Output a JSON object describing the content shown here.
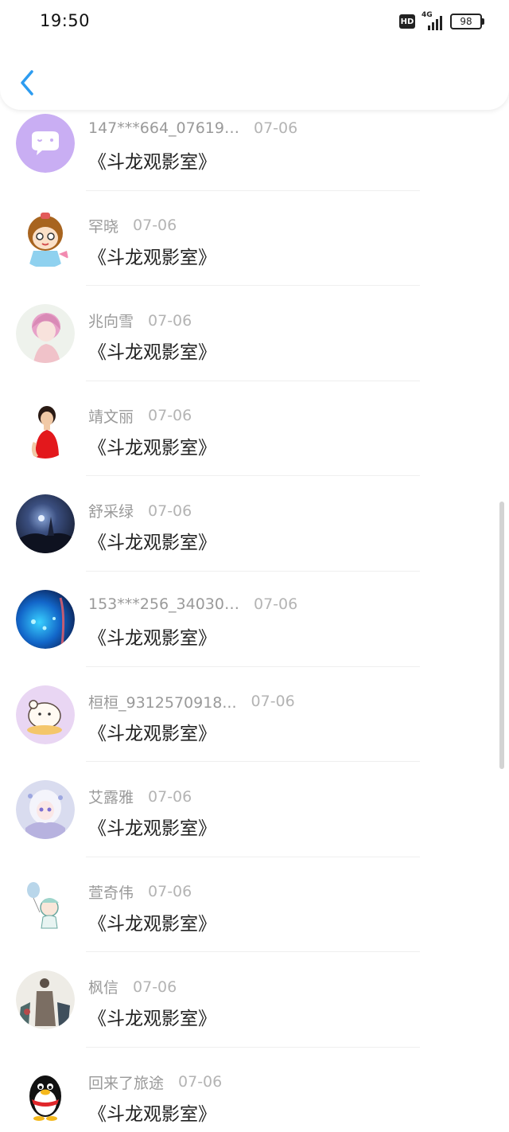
{
  "status_bar": {
    "time": "19:50",
    "hd": "HD",
    "network": "4G",
    "battery": "98"
  },
  "colors": {
    "back_accent": "#2d9cf0"
  },
  "comments": [
    {
      "name": "147***664_076193...",
      "date": "07-06",
      "text": "《斗龙观影室》",
      "avatar": "chat-bubble-icon"
    },
    {
      "name": "罕晓",
      "date": "07-06",
      "text": "《斗龙观影室》",
      "avatar": "cartoon-girl-avatar"
    },
    {
      "name": "兆向雪",
      "date": "07-06",
      "text": "《斗龙观影室》",
      "avatar": "pink-hair-girl-avatar"
    },
    {
      "name": "靖文丽",
      "date": "07-06",
      "text": "《斗龙观影室》",
      "avatar": "woman-red-dress-avatar"
    },
    {
      "name": "舒采绿",
      "date": "07-06",
      "text": "《斗龙观影室》",
      "avatar": "night-sky-avatar"
    },
    {
      "name": "153***256_340306...",
      "date": "07-06",
      "text": "《斗龙观影室》",
      "avatar": "blue-glow-avatar"
    },
    {
      "name": "桓桓_9312570918...",
      "date": "07-06",
      "text": "《斗龙观影室》",
      "avatar": "cartoon-bear-avatar"
    },
    {
      "name": "艾露雅",
      "date": "07-06",
      "text": "《斗龙观影室》",
      "avatar": "anime-girl-avatar"
    },
    {
      "name": "萱奇伟",
      "date": "07-06",
      "text": "《斗龙观影室》",
      "avatar": "balloon-boy-avatar"
    },
    {
      "name": "枫信",
      "date": "07-06",
      "text": "《斗龙观影室》",
      "avatar": "sketch-figures-avatar"
    },
    {
      "name": "回来了旅途",
      "date": "07-06",
      "text": "《斗龙观影室》",
      "avatar": "penguin-avatar"
    }
  ]
}
